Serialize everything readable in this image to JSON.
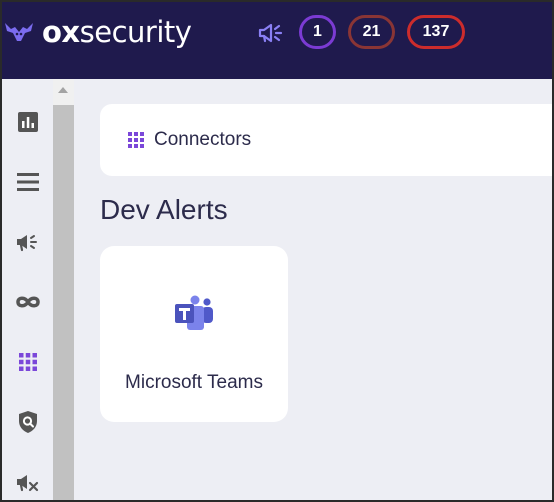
{
  "header": {
    "logo": {
      "brand_bold": "ox",
      "brand_regular": "security"
    },
    "alert_icon": "megaphone-icon",
    "badges": [
      {
        "value": "1",
        "color": "#7b3bd3"
      },
      {
        "value": "21",
        "color": "#8a3535"
      },
      {
        "value": "137",
        "color": "#cc2c2c"
      }
    ]
  },
  "sidebar": {
    "items": [
      {
        "icon": "dashboard-chart-icon",
        "active": false
      },
      {
        "icon": "list-icon",
        "active": false
      },
      {
        "icon": "megaphone-icon",
        "active": false
      },
      {
        "icon": "infinity-icon",
        "active": false
      },
      {
        "icon": "grid-apps-icon",
        "active": true
      },
      {
        "icon": "shield-search-icon",
        "active": false
      },
      {
        "icon": "megaphone-off-icon",
        "active": false
      }
    ]
  },
  "breadcrumb": {
    "icon": "grid-apps-icon",
    "label": "Connectors"
  },
  "section": {
    "title": "Dev Alerts"
  },
  "connectors": [
    {
      "name": "Microsoft Teams",
      "icon": "microsoft-teams-icon"
    }
  ],
  "colors": {
    "header_bg": "#1f1a4d",
    "accent": "#7b47d9",
    "page_bg": "#edeef4",
    "text": "#2c2b4b",
    "icon_gray": "#555555"
  }
}
